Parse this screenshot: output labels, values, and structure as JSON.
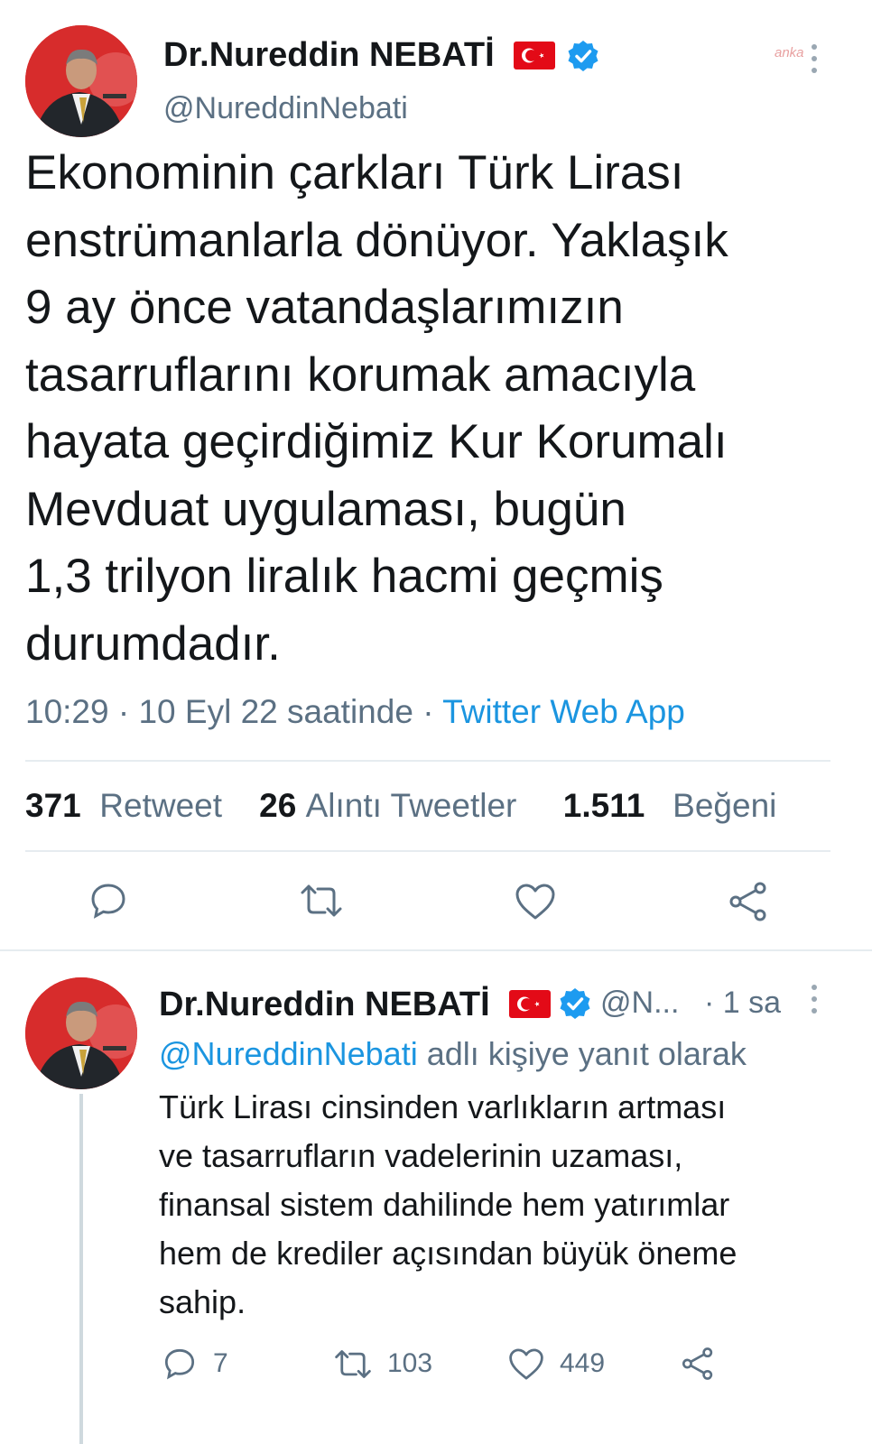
{
  "watermark": "anka",
  "tweet": {
    "author_name": "Dr.Nureddin NEBATİ",
    "author_handle": "@NureddinNebati",
    "text_lines": [
      "Ekonominin çarkları Türk Lirası",
      "enstrümanlarla dönüyor. Yaklaşık",
      "9 ay önce vatandaşlarımızın",
      "tasarruflarını korumak amacıyla",
      "hayata geçirdiğimiz Kur Korumalı",
      "Mevduat uygulaması, bugün",
      "1,3 trilyon liralık hacmi geçmiş",
      "durumdadır."
    ],
    "time": "10:29 · 10 Eyl 22 saatinde · ",
    "source": "Twitter Web App",
    "retweets": "371",
    "retweets_label": "Retweet",
    "quotes": "26",
    "quotes_label": "Alıntı Tweetler",
    "likes": "1.511",
    "likes_label": "Beğeni"
  },
  "reply": {
    "author_name": "Dr.Nureddin NEBATİ",
    "author_handle": "@N...",
    "time": "· 1 sa",
    "replying_mention": "@NureddinNebati",
    "replying_text": " adlı kişiye yanıt olarak",
    "text_lines": [
      "Türk Lirası cinsinden varlıkların artması",
      "ve tasarrufların vadelerinin uzaması,",
      "finansal sistem dahilinde hem yatırımlar",
      "hem de krediler açısından büyük öneme",
      "sahip."
    ],
    "reply_count": "7",
    "retweet_count": "103",
    "like_count": "449"
  },
  "colors": {
    "accent": "#1b95e0",
    "verified": "#1d9bf0",
    "flag": "#e30a17"
  }
}
